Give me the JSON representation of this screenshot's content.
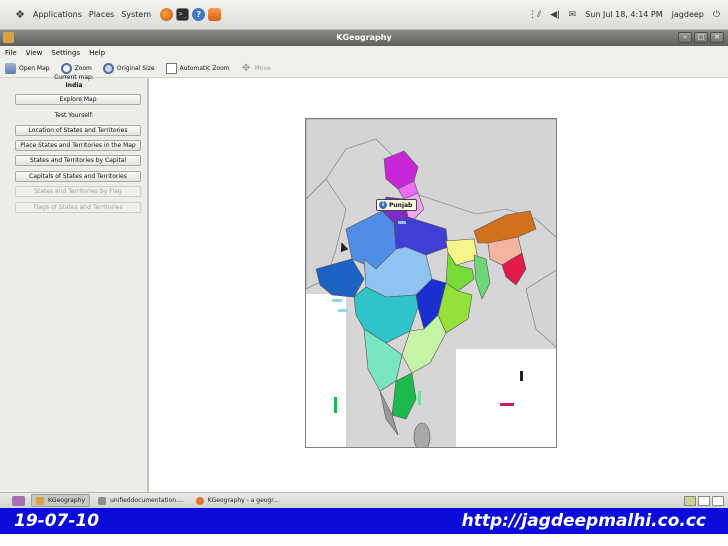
{
  "top_panel": {
    "menus": [
      "Applications",
      "Places",
      "System"
    ],
    "datetime": "Sun Jul 18,  4:14 PM",
    "user": "jagdeep",
    "icons": [
      "gnome-foot-icon",
      "firefox-icon",
      "terminal-icon",
      "help-icon",
      "app-launcher-icon",
      "network-icon",
      "volume-icon",
      "mail-icon",
      "power-icon"
    ]
  },
  "window": {
    "title": "KGeography",
    "buttons": [
      "minimize",
      "maximize",
      "close"
    ]
  },
  "menubar": [
    "File",
    "View",
    "Settings",
    "Help"
  ],
  "toolbar": {
    "open_map": "Open Map",
    "zoom": "Zoom",
    "original_size": "Original Size",
    "automatic_zoom": "Automatic Zoom",
    "move": "Move"
  },
  "left_panel": {
    "current_map_label": "Current map:",
    "current_map_value": "India",
    "explore_button": "Explore Map",
    "test_label": "Test Yourself:",
    "tests": [
      {
        "label": "Location of States and Territories",
        "enabled": true
      },
      {
        "label": "Place States and Territories in the Map",
        "enabled": true
      },
      {
        "label": "States and Territories by Capital",
        "enabled": true
      },
      {
        "label": "Capitals of States and Territories",
        "enabled": true
      },
      {
        "label": "States and Territories by Flag",
        "enabled": false
      },
      {
        "label": "Flags of States and Territories",
        "enabled": false
      }
    ]
  },
  "map": {
    "tooltip": "Punjab"
  },
  "taskbar": {
    "tasks": [
      {
        "label": "KGeography",
        "active": true
      },
      {
        "label": "unifieddocumentation....",
        "active": false
      },
      {
        "label": "KGeography - a geogr...",
        "active": false
      }
    ]
  },
  "caption": {
    "date": "19-07-10",
    "url": "http://jagdeepmalhi.co.cc"
  },
  "colors": {
    "caption_bar": "#0c0cd8",
    "map_background": "#d6d6d6"
  }
}
